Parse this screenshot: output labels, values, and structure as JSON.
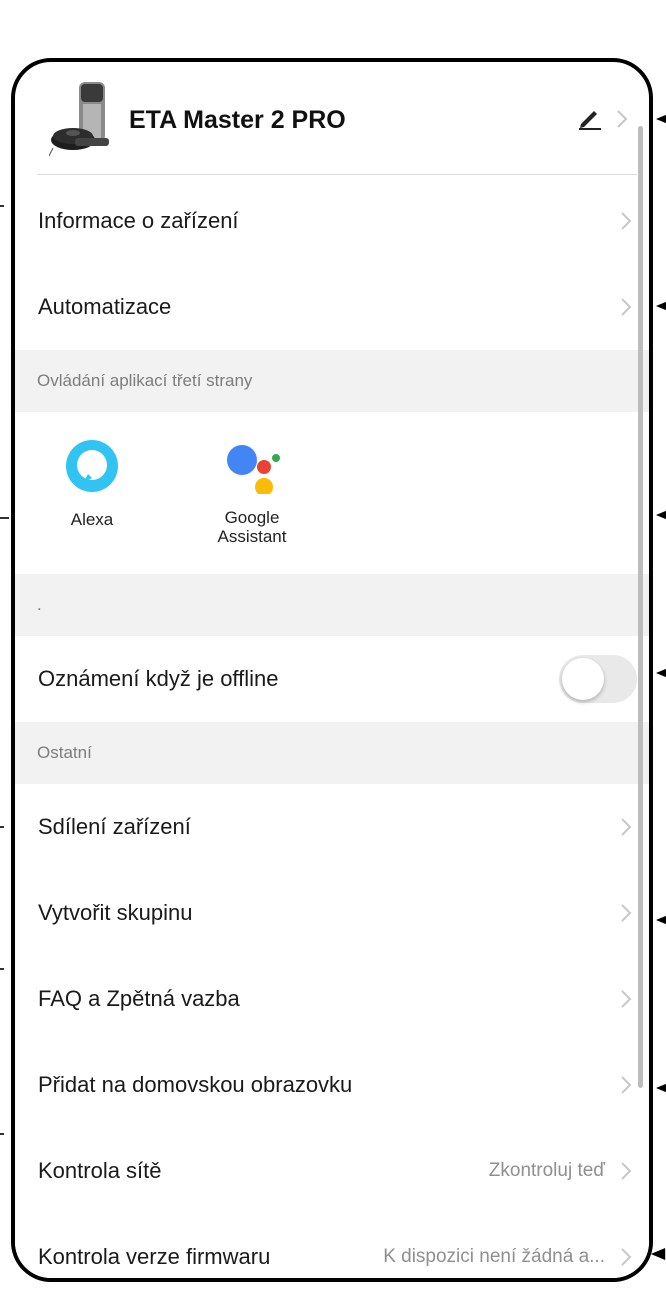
{
  "device": {
    "name": "ETA Master 2 PRO",
    "image_icon": "robot-vacuum-icon",
    "edit_icon": "pencil-icon"
  },
  "rows_top": [
    {
      "label": "Informace o zařízení"
    },
    {
      "label": "Automatizace"
    }
  ],
  "third_party": {
    "section_title": "Ovládání aplikací třetí strany",
    "apps": [
      {
        "label": "Alexa",
        "icon": "alexa-icon"
      },
      {
        "label": "Google Assistant",
        "icon": "google-assistant-icon"
      }
    ]
  },
  "dot_section": {
    "title": "."
  },
  "offline_notification": {
    "label": "Oznámení když je offline",
    "enabled": false
  },
  "other": {
    "section_title": "Ostatní",
    "rows": [
      {
        "label": "Sdílení zařízení",
        "value": ""
      },
      {
        "label": "Vytvořit skupinu",
        "value": ""
      },
      {
        "label": "FAQ a Zpětná vazba",
        "value": ""
      },
      {
        "label": "Přidat na domovskou obrazovku",
        "value": ""
      },
      {
        "label": "Kontrola sítě",
        "value": "Zkontroluj teď"
      },
      {
        "label": "Kontrola verze firmwaru",
        "value": "K dispozici není žádná a..."
      }
    ]
  },
  "colors": {
    "section_bg": "#f2f2f2",
    "toggle_off": "#e9e9ea",
    "alexa_blue": "#31c4f3",
    "google_blue": "#4285f4",
    "google_red": "#ea4335",
    "google_yellow": "#fbbc05",
    "google_green": "#34a853"
  }
}
